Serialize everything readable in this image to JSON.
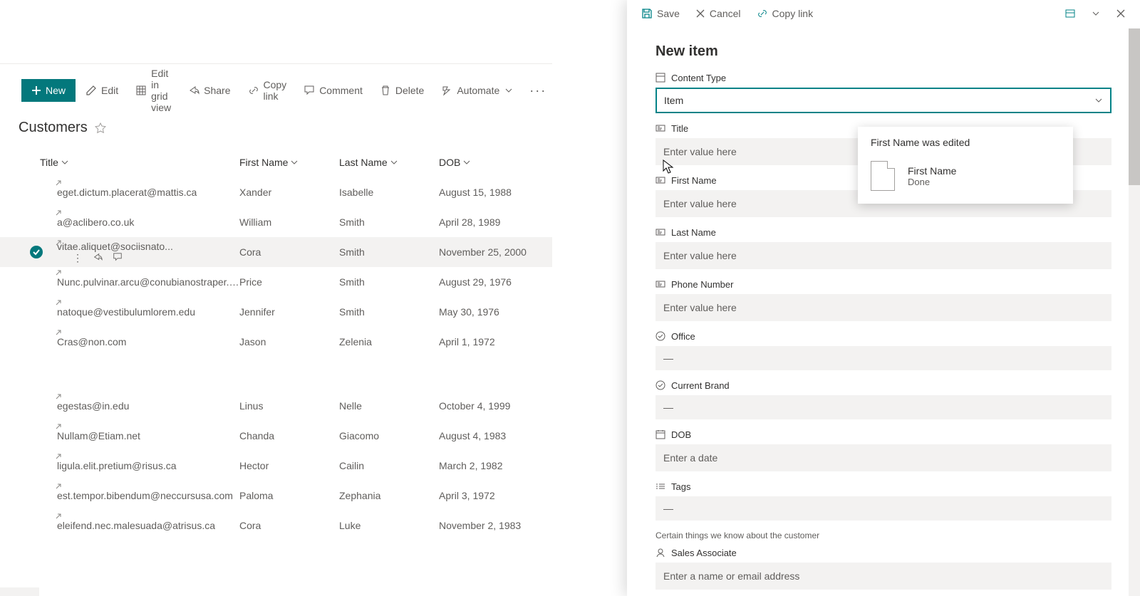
{
  "toolbar": {
    "new": "New",
    "edit": "Edit",
    "edit_grid": "Edit in grid view",
    "share": "Share",
    "copy_link": "Copy link",
    "comment": "Comment",
    "delete": "Delete",
    "automate": "Automate"
  },
  "list": {
    "title": "Customers",
    "cols": {
      "title": "Title",
      "first": "First Name",
      "last": "Last Name",
      "dob": "DOB"
    }
  },
  "rows": [
    {
      "title": "eget.dictum.placerat@mattis.ca",
      "first": "Xander",
      "last": "Isabelle",
      "dob": "August 15, 1988",
      "sel": false
    },
    {
      "title": "a@aclibero.co.uk",
      "first": "William",
      "last": "Smith",
      "dob": "April 28, 1989",
      "sel": false
    },
    {
      "title": "vitae.aliquet@sociisnato...",
      "first": "Cora",
      "last": "Smith",
      "dob": "November 25, 2000",
      "sel": true
    },
    {
      "title": "Nunc.pulvinar.arcu@conubianostraper.edu",
      "first": "Price",
      "last": "Smith",
      "dob": "August 29, 1976",
      "sel": false
    },
    {
      "title": "natoque@vestibulumlorem.edu",
      "first": "Jennifer",
      "last": "Smith",
      "dob": "May 30, 1976",
      "sel": false
    },
    {
      "title": "Cras@non.com",
      "first": "Jason",
      "last": "Zelenia",
      "dob": "April 1, 1972",
      "sel": false
    },
    {
      "title": "egestas@in.edu",
      "first": "Linus",
      "last": "Nelle",
      "dob": "October 4, 1999",
      "sel": false
    },
    {
      "title": "Nullam@Etiam.net",
      "first": "Chanda",
      "last": "Giacomo",
      "dob": "August 4, 1983",
      "sel": false
    },
    {
      "title": "ligula.elit.pretium@risus.ca",
      "first": "Hector",
      "last": "Cailin",
      "dob": "March 2, 1982",
      "sel": false
    },
    {
      "title": "est.tempor.bibendum@neccursusa.com",
      "first": "Paloma",
      "last": "Zephania",
      "dob": "April 3, 1972",
      "sel": false
    },
    {
      "title": "eleifend.nec.malesuada@atrisus.ca",
      "first": "Cora",
      "last": "Luke",
      "dob": "November 2, 1983",
      "sel": false
    }
  ],
  "panel": {
    "save": "Save",
    "cancel": "Cancel",
    "copy_link": "Copy link",
    "title": "New item",
    "content_type_label": "Content Type",
    "content_type_value": "Item",
    "fields": {
      "title": {
        "label": "Title",
        "ph": "Enter value here"
      },
      "first": {
        "label": "First Name",
        "ph": "Enter value here"
      },
      "last": {
        "label": "Last Name",
        "ph": "Enter value here"
      },
      "phone": {
        "label": "Phone Number",
        "ph": "Enter value here"
      },
      "office": {
        "label": "Office",
        "val": "—"
      },
      "brand": {
        "label": "Current Brand",
        "val": "—"
      },
      "dob": {
        "label": "DOB",
        "ph": "Enter a date"
      },
      "tags": {
        "label": "Tags",
        "val": "—",
        "help": "Certain things we know about the customer"
      },
      "sales": {
        "label": "Sales Associate",
        "ph": "Enter a name or email address"
      }
    }
  },
  "toast": {
    "title": "First Name was edited",
    "field": "First Name",
    "status": "Done"
  }
}
